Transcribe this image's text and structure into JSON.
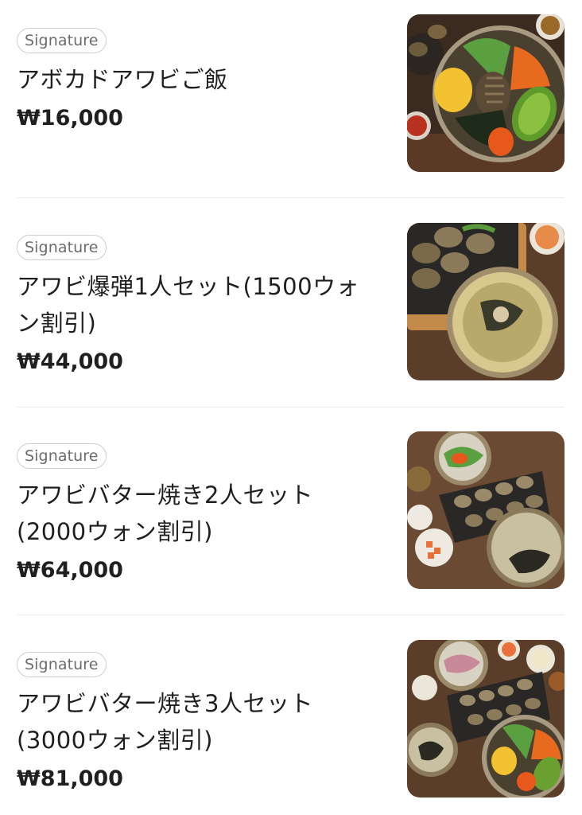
{
  "menu": {
    "items": [
      {
        "badge": "Signature",
        "name": "アボカドアワビご飯",
        "price": "₩16,000",
        "image": "avocado-abalone-rice-photo"
      },
      {
        "badge": "Signature",
        "name": "アワビ爆弾1人セット(1500ウォン割引)",
        "price": "₩44,000",
        "image": "abalone-bomb-1-person-set-photo"
      },
      {
        "badge": "Signature",
        "name": "アワビバター焼き2人セット(2000ウォン割引)",
        "price": "₩64,000",
        "image": "abalone-butter-grill-2-person-set-photo"
      },
      {
        "badge": "Signature",
        "name": "アワビバター焼き3人セット(3000ウォン割引)",
        "price": "₩81,000",
        "image": "abalone-butter-grill-3-person-set-photo"
      }
    ]
  },
  "colors": {
    "text": "#1f1f21",
    "badge_border": "#cfcfd3",
    "badge_text": "#6b6b70",
    "divider": "#ececee"
  }
}
